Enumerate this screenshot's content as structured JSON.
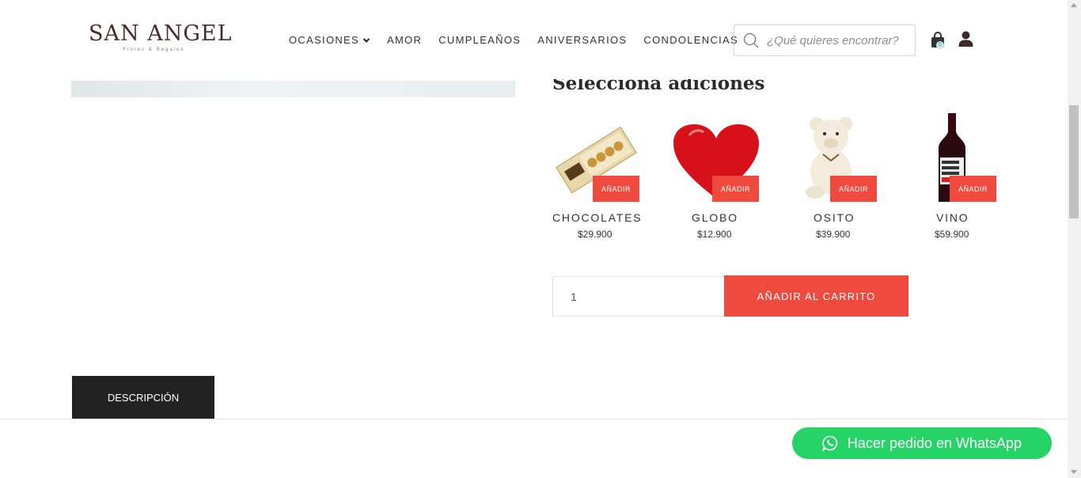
{
  "brand": {
    "name": "SAN ANGEL",
    "tagline": "Flores & Regalos"
  },
  "nav": {
    "items": [
      "OCASIONES",
      "AMOR",
      "CUMPLEAÑOS",
      "ANIVERSARIOS",
      "CONDOLENCIAS"
    ]
  },
  "search": {
    "placeholder": "¿Qué quieres encontrar?"
  },
  "cart": {
    "count": "0"
  },
  "additions": {
    "title": "Selecciona adiciones",
    "button_label": "AÑADIR",
    "items": [
      {
        "name": "CHOCOLATES",
        "price": "$29.900",
        "icon": "chocolates-box"
      },
      {
        "name": "GLOBO",
        "price": "$12.900",
        "icon": "heart-balloon"
      },
      {
        "name": "OSITO",
        "price": "$39.900",
        "icon": "teddy-bear"
      },
      {
        "name": "VINO",
        "price": "$59.900",
        "icon": "wine-bottle"
      }
    ]
  },
  "purchase": {
    "quantity": "1",
    "add_to_cart_label": "AÑADIR AL CARRITO"
  },
  "tabs": {
    "description_label": "DESCRIPCIÓN"
  },
  "whatsapp": {
    "label": "Hacer pedido en WhatsApp"
  },
  "colors": {
    "accent": "#f04a3e",
    "whatsapp": "#25d366",
    "dark": "#222222",
    "brand": "#4a2b2b"
  }
}
